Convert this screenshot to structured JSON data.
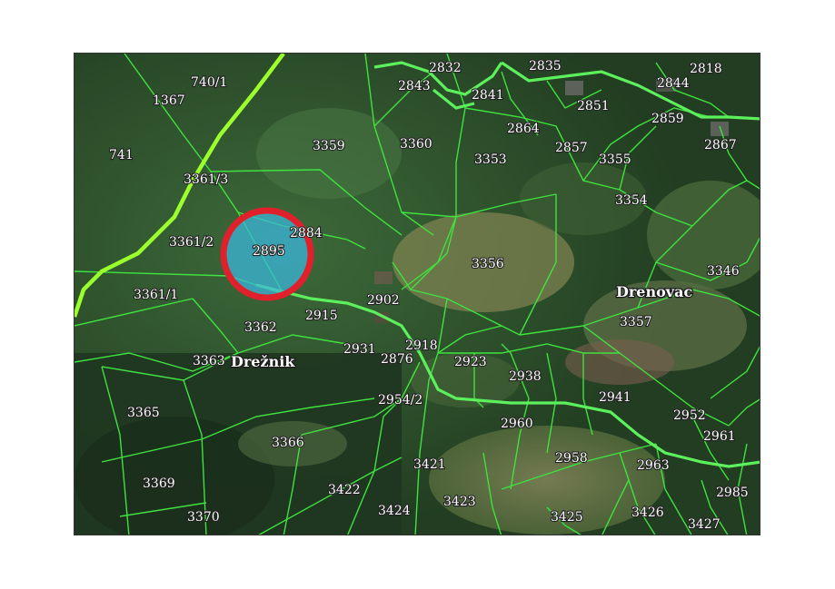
{
  "map": {
    "parcels": [
      "740/1",
      "1367",
      "741",
      "3359",
      "3360",
      "2832",
      "2843",
      "2841",
      "2835",
      "2818",
      "2844",
      "2851",
      "2859",
      "2864",
      "2867",
      "2857",
      "3353",
      "3355",
      "3361/3",
      "3354",
      "2884",
      "3361/2",
      "2895",
      "3356",
      "3346",
      "3361/1",
      "2902",
      "Drenovac",
      "2915",
      "3357",
      "3362",
      "2931",
      "2918",
      "3363",
      "2876",
      "2923",
      "2938",
      "2941",
      "2954/2",
      "2952",
      "3365",
      "2960",
      "2961",
      "3366",
      "2958",
      "3421",
      "2963",
      "3369",
      "3422",
      "2985",
      "3423",
      "3424",
      "3426",
      "3370",
      "3425",
      "3427"
    ],
    "places": [
      "Drežnik",
      "Drenovac"
    ],
    "highlight": {
      "parcel": "2895",
      "ring_color": "#e0202a",
      "fill_color": "#3ab8e0"
    },
    "colors": {
      "parcel_border": "#3fe23f",
      "road": "#5cf05c",
      "highway": "#9cff2e"
    }
  }
}
